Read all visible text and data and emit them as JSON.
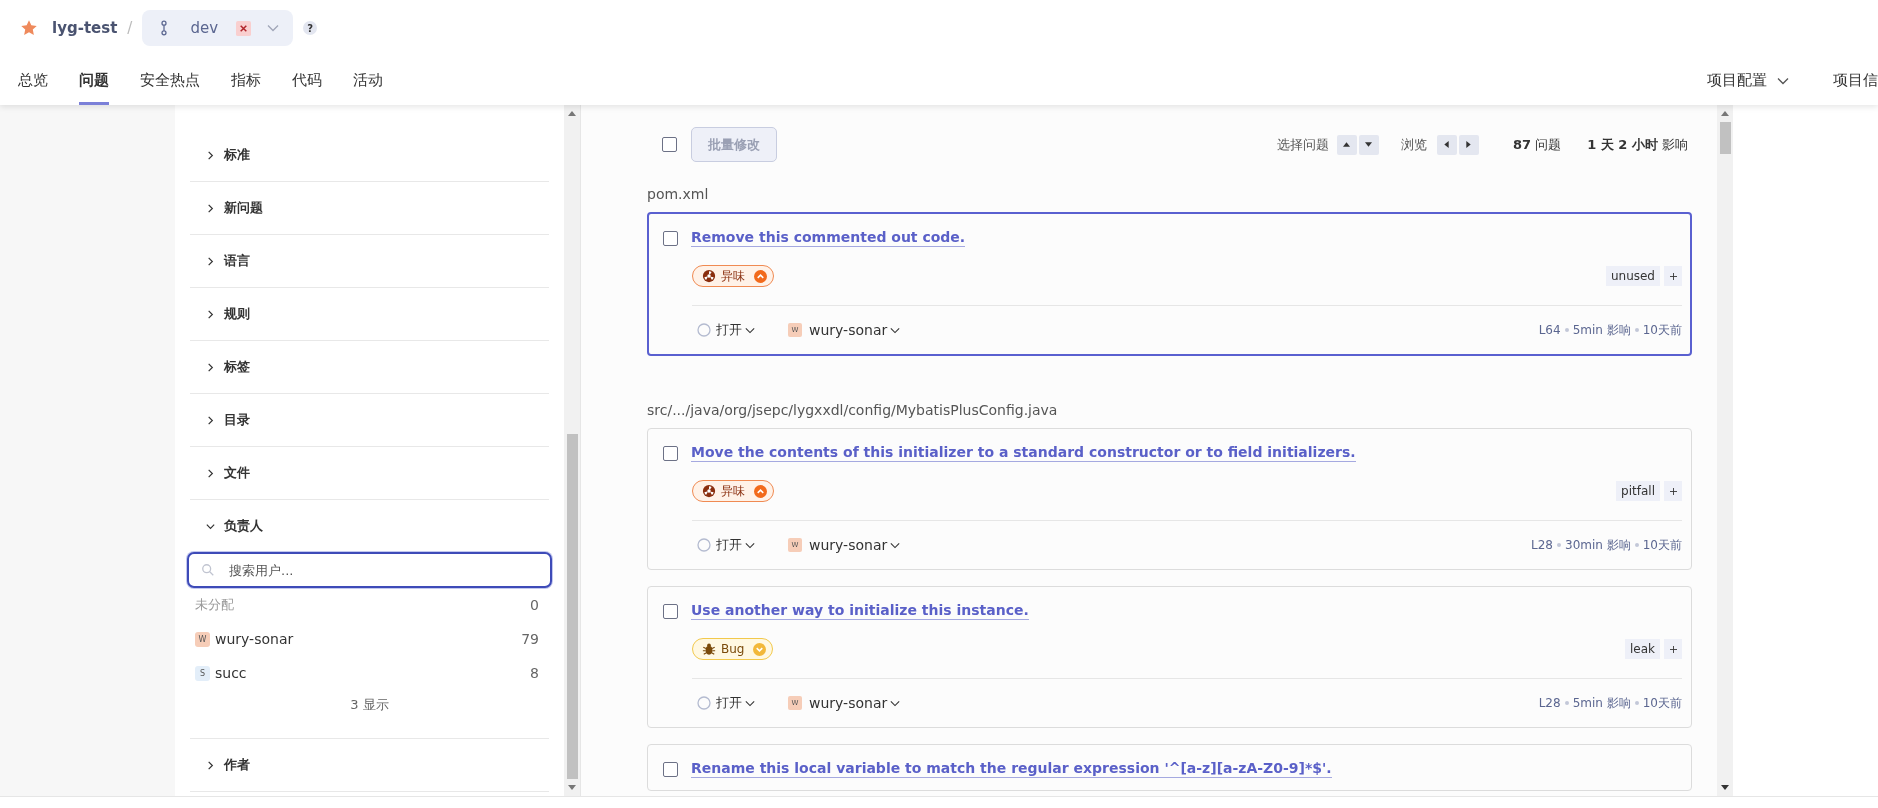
{
  "breadcrumb": {
    "project": "lyg-test",
    "separator": "/",
    "branch": "dev",
    "help": "?"
  },
  "nav_tabs": [
    {
      "label": "总览",
      "selected": false
    },
    {
      "label": "问题",
      "selected": true
    },
    {
      "label": "安全热点",
      "selected": false
    },
    {
      "label": "指标",
      "selected": false
    },
    {
      "label": "代码",
      "selected": false
    },
    {
      "label": "活动",
      "selected": false
    }
  ],
  "nav_right": [
    {
      "label": "项目配置",
      "dropdown": true
    },
    {
      "label": "项目信",
      "dropdown": false
    }
  ],
  "filters": [
    {
      "label": "标准",
      "expanded": false
    },
    {
      "label": "新问题",
      "expanded": false
    },
    {
      "label": "语言",
      "expanded": false
    },
    {
      "label": "规则",
      "expanded": false
    },
    {
      "label": "标签",
      "expanded": false
    },
    {
      "label": "目录",
      "expanded": false
    },
    {
      "label": "文件",
      "expanded": false
    },
    {
      "label": "负责人",
      "expanded": true,
      "search": {
        "placeholder": "搜索用户..."
      },
      "items": [
        {
          "name": "未分配",
          "count": "0"
        },
        {
          "name": "wury-sonar",
          "count": "79",
          "avatar": "W",
          "color": "#f6cdb8"
        },
        {
          "name": "succ",
          "count": "8",
          "avatar": "S",
          "color": "#e3eef9"
        }
      ],
      "show_more": "3 显示"
    },
    {
      "label": "作者",
      "expanded": false
    }
  ],
  "toolbar": {
    "select_all": {
      "checked": false
    },
    "bulk_button": {
      "label": "批量修改",
      "disabled": true
    },
    "select_issue": "选择问题",
    "browse": "浏览",
    "count": "**87** 问题",
    "effort": "**1 天 2 小时** 影响"
  },
  "groups": [
    {
      "path": "pom.xml",
      "issues": [
        {
          "title": "Remove this commented out code.",
          "selected": true,
          "checked": false,
          "type": {
            "kind": "smell",
            "label": "异味"
          },
          "tags": [
            "unused"
          ],
          "status": "打开",
          "assignee": {
            "avatar": "W",
            "name": "wury-sonar"
          },
          "line": "L64",
          "effort": "5min 影响",
          "age": "10天前"
        }
      ]
    },
    {
      "path": "src/.../java/org/jsepc/lygxxdl/config/MybatisPlusConfig.java",
      "issues": [
        {
          "title": "Move the contents of this initializer to a standard constructor or to field initializers.",
          "selected": false,
          "checked": false,
          "type": {
            "kind": "smell",
            "label": "异味"
          },
          "tags": [
            "pitfall"
          ],
          "status": "打开",
          "assignee": {
            "avatar": "W",
            "name": "wury-sonar"
          },
          "line": "L28",
          "effort": "30min 影响",
          "age": "10天前"
        },
        {
          "title": "Use another way to initialize this instance.",
          "selected": false,
          "checked": false,
          "type": {
            "kind": "bug",
            "label": "Bug"
          },
          "tags": [
            "leak"
          ],
          "status": "打开",
          "assignee": {
            "avatar": "W",
            "name": "wury-sonar"
          },
          "line": "L28",
          "effort": "5min 影响",
          "age": "10天前"
        },
        {
          "title": "Rename this local variable to match the regular expression '^[a-z][a-zA-Z0-9]*$'.",
          "selected": false,
          "checked": false
        }
      ]
    }
  ]
}
